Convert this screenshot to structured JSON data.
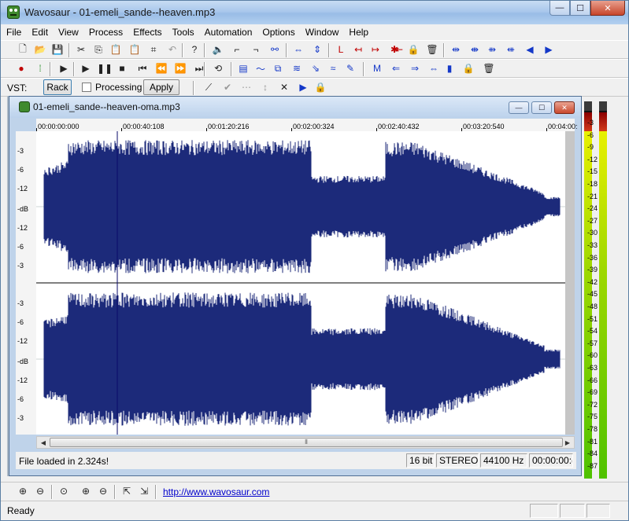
{
  "window": {
    "title": "Wavosaur - 01-emeli_sande--heaven.mp3",
    "buttons": {
      "minimize": "—",
      "maximize": "☐",
      "close": "✕"
    }
  },
  "menu": [
    "File",
    "Edit",
    "View",
    "Process",
    "Effects",
    "Tools",
    "Automation",
    "Options",
    "Window",
    "Help"
  ],
  "toolbar1": [
    {
      "name": "new-file-icon",
      "glyph": "🗋"
    },
    {
      "name": "open-folder-icon",
      "glyph": "📂"
    },
    {
      "name": "save-icon",
      "glyph": "💾"
    },
    {
      "name": "cut-icon",
      "glyph": "✂"
    },
    {
      "name": "copy-icon",
      "glyph": "⎘"
    },
    {
      "name": "paste-icon",
      "glyph": "📋"
    },
    {
      "name": "paste-mix-icon",
      "glyph": "📋"
    },
    {
      "name": "crop-icon",
      "glyph": "⌗"
    },
    {
      "name": "undo-icon",
      "glyph": "↶"
    },
    {
      "name": "help-icon",
      "glyph": "?"
    },
    {
      "name": "speaker-icon",
      "glyph": "🔈"
    },
    {
      "name": "fade-in-icon",
      "glyph": "⌐"
    },
    {
      "name": "fade-out-icon",
      "glyph": "¬"
    },
    {
      "name": "crossfade-icon",
      "glyph": "⚯"
    },
    {
      "name": "normalize-icon",
      "glyph": "⇔"
    },
    {
      "name": "gain-icon",
      "glyph": "⇕"
    },
    {
      "name": "marker-start-icon",
      "glyph": "L"
    },
    {
      "name": "marker-left-icon",
      "glyph": "↤"
    },
    {
      "name": "marker-right-icon",
      "glyph": "↦"
    },
    {
      "name": "marker-split-icon",
      "glyph": "✱"
    },
    {
      "name": "marker-prev-icon",
      "glyph": "⇤"
    },
    {
      "name": "lock-icon",
      "glyph": "🔒"
    },
    {
      "name": "trash-icon",
      "glyph": "🗑"
    },
    {
      "name": "zoom-wave-icon",
      "glyph": "⇹"
    },
    {
      "name": "zoom-in-wave-icon",
      "glyph": "⇼"
    },
    {
      "name": "zoom-select-icon",
      "glyph": "⇻"
    },
    {
      "name": "zoom-out-wave-icon",
      "glyph": "⇺"
    },
    {
      "name": "prev-region-icon",
      "glyph": "◀"
    },
    {
      "name": "next-region-icon",
      "glyph": "▶"
    }
  ],
  "toolbar2": [
    {
      "name": "record-icon",
      "glyph": "●"
    },
    {
      "name": "record-settings-icon",
      "glyph": "⁞"
    },
    {
      "name": "play-from-start-icon",
      "glyph": "▶"
    },
    {
      "name": "play-icon",
      "glyph": "▶"
    },
    {
      "name": "pause-icon",
      "glyph": "❚❚"
    },
    {
      "name": "stop-icon",
      "glyph": "■"
    },
    {
      "name": "skip-start-icon",
      "glyph": "⏮"
    },
    {
      "name": "rewind-icon",
      "glyph": "⏪"
    },
    {
      "name": "fast-forward-icon",
      "glyph": "⏩"
    },
    {
      "name": "skip-end-icon",
      "glyph": "⏭"
    },
    {
      "name": "loop-icon",
      "glyph": "⟲"
    },
    {
      "name": "batch-icon",
      "glyph": "▤"
    },
    {
      "name": "spectrum-icon",
      "glyph": "〜"
    },
    {
      "name": "convert-icon",
      "glyph": "⧉"
    },
    {
      "name": "resample-icon",
      "glyph": "≋"
    },
    {
      "name": "filter-icon",
      "glyph": "⇘"
    },
    {
      "name": "eq-icon",
      "glyph": "≈"
    },
    {
      "name": "pencil-icon",
      "glyph": "✎"
    },
    {
      "name": "marker-m-icon",
      "glyph": "M"
    },
    {
      "name": "marker-back-icon",
      "glyph": "⇐"
    },
    {
      "name": "marker-fwd-icon",
      "glyph": "⇒"
    },
    {
      "name": "marker-join-icon",
      "glyph": "⇔"
    },
    {
      "name": "marker-select-icon",
      "glyph": "▮"
    },
    {
      "name": "marker-lock-icon",
      "glyph": "🔒"
    },
    {
      "name": "marker-trash-icon",
      "glyph": "🗑"
    }
  ],
  "vst": {
    "label": "VST:",
    "rack": "Rack",
    "processing": "Processing",
    "apply": "Apply"
  },
  "toolbar3": [
    {
      "name": "envelope-icon",
      "glyph": "⟋"
    },
    {
      "name": "check-icon",
      "glyph": "✔"
    },
    {
      "name": "points-icon",
      "glyph": "⋯"
    },
    {
      "name": "spread-icon",
      "glyph": "↕"
    },
    {
      "name": "delete-x-icon",
      "glyph": "✕"
    },
    {
      "name": "select-play-icon",
      "glyph": "▶"
    },
    {
      "name": "env-lock-icon",
      "glyph": "🔒"
    }
  ],
  "document": {
    "title": "01-emeli_sande--heaven-oma.mp3",
    "ruler": [
      "00:00:00:000",
      "00:00:40:108",
      "00:01:20:216",
      "00:02:00:324",
      "00:02:40:432",
      "00:03:20:540",
      "00:04:00:"
    ],
    "db_labels_top": [
      "-3",
      "-6",
      "-12",
      "-dB",
      "-12",
      "-6",
      "-3"
    ],
    "db_labels_bottom": [
      "-3",
      "-6",
      "-12",
      "-dB",
      "-12",
      "-6",
      "-3"
    ],
    "waveform_color": "#1c2a7a",
    "cursor_position_fraction": 0.153,
    "status": {
      "message": "File loaded in 2.324s!",
      "bits": "16 bit",
      "channels": "STEREO",
      "rate": "44100 Hz",
      "time": "00:00:00:("
    },
    "hscroll_grip": "⦀"
  },
  "meter": {
    "labels": [
      "-3",
      "-6",
      "-9",
      "-12",
      "-15",
      "-18",
      "-21",
      "-24",
      "-27",
      "-30",
      "-33",
      "-36",
      "-39",
      "-42",
      "-45",
      "-48",
      "-51",
      "-54",
      "-57",
      "-60",
      "-63",
      "-66",
      "-69",
      "-72",
      "-75",
      "-78",
      "-81",
      "-84",
      "-87"
    ],
    "colors": {
      "peak": "#d33a1a",
      "high": "#e8f000",
      "low": "#4fc200"
    }
  },
  "bottom_toolbar": [
    {
      "name": "zoom-in-icon",
      "glyph": "⊕"
    },
    {
      "name": "zoom-out-icon",
      "glyph": "⊖"
    },
    {
      "name": "zoom-full-icon",
      "glyph": "⊙"
    },
    {
      "name": "zoom-in-v-icon",
      "glyph": "⊕"
    },
    {
      "name": "zoom-out-v-icon",
      "glyph": "⊖"
    },
    {
      "name": "fit-h-icon",
      "glyph": "⇱"
    },
    {
      "name": "fit-v-icon",
      "glyph": "⇲"
    }
  ],
  "link": "http://www.wavosaur.com",
  "status_bar": {
    "ready": "Ready"
  }
}
